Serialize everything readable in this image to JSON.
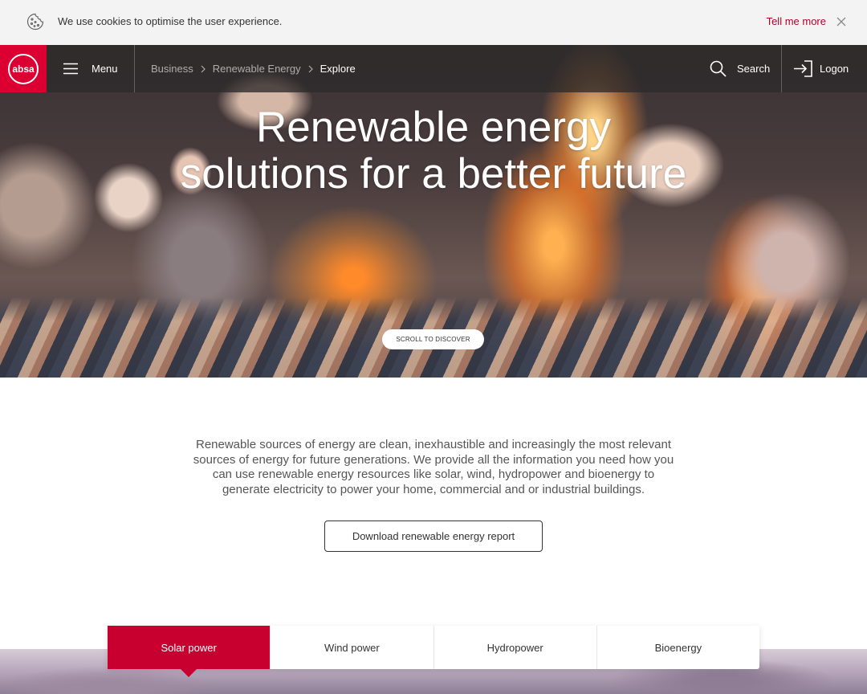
{
  "cookie_bar": {
    "icon": "cookie-icon",
    "message": "We use cookies to optimise the user experience.",
    "more_label": "Tell me more",
    "close_icon": "close-icon"
  },
  "header": {
    "logo_text": "absa",
    "brand_color": "#dc0032",
    "menu_label": "Menu",
    "breadcrumb": [
      {
        "label": "Business"
      },
      {
        "label": "Renewable Energy"
      },
      {
        "label": "Explore"
      }
    ],
    "search_label": "Search",
    "logon_label": "Logon"
  },
  "hero": {
    "title_line1": "Renewable energy",
    "title_line2": "solutions for a better future",
    "scroll_label": "SCROLL TO DISCOVER"
  },
  "intro": {
    "text": "Renewable sources of energy are clean, inexhaustible and increasingly the most relevant sources of energy for future generations. We provide all the information you need how you can use renewable energy resources like solar, wind, hydropower and bioenergy to generate electricity to power your home, commercial and or industrial buildings.",
    "download_label": "Download renewable energy report"
  },
  "tabs": [
    {
      "label": "Solar power",
      "active": true
    },
    {
      "label": "Wind power",
      "active": false
    },
    {
      "label": "Hydropower",
      "active": false
    },
    {
      "label": "Bioenergy",
      "active": false
    }
  ],
  "colors": {
    "accent": "#c8002f",
    "link": "#b0002c"
  }
}
